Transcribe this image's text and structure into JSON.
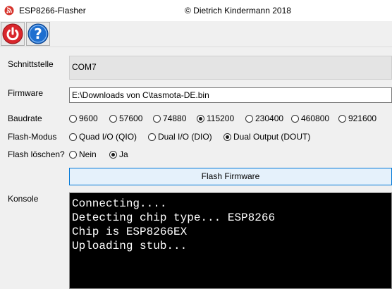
{
  "window": {
    "title": "ESP8266-Flasher",
    "copyright": "© Dietrich Kindermann 2018"
  },
  "toolbar": {
    "quit_icon": "power-icon",
    "quit_color": "#d9262c",
    "help_icon": "help-icon",
    "help_color": "#1e6fd0"
  },
  "form": {
    "port_label": "Schnittstelle",
    "port_value": "COM7",
    "firmware_label": "Firmware",
    "firmware_value": "E:\\Downloads von C\\tasmota-DE.bin",
    "baud_label": "Baudrate",
    "baud_options": [
      "9600",
      "57600",
      "74880",
      "115200",
      "230400",
      "460800",
      "921600"
    ],
    "baud_selected": "115200",
    "mode_label": "Flash-Modus",
    "mode_options": [
      "Quad I/O (QIO)",
      "Dual I/O (DIO)",
      "Dual Output (DOUT)"
    ],
    "mode_selected": "Dual Output (DOUT)",
    "erase_label": "Flash löschen?",
    "erase_options": [
      "Nein",
      "Ja"
    ],
    "erase_selected": "Ja",
    "flash_button": "Flash Firmware",
    "console_label": "Konsole"
  },
  "console": {
    "lines": [
      "Connecting....",
      "Detecting chip type... ESP8266",
      "Chip is ESP8266EX",
      "Uploading stub..."
    ]
  }
}
